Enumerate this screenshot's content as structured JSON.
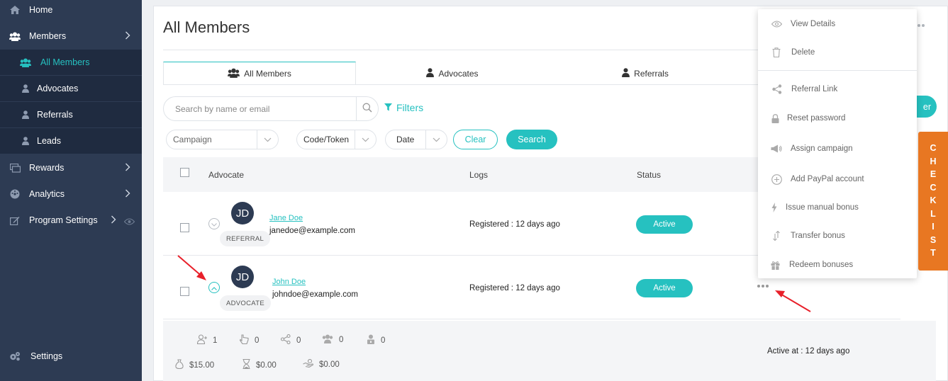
{
  "sidebar": {
    "items": [
      {
        "label": "Home",
        "icon": "home-icon"
      },
      {
        "label": "Members",
        "icon": "users-icon"
      },
      {
        "label": "Rewards",
        "icon": "rewards-icon"
      },
      {
        "label": "Analytics",
        "icon": "analytics-icon"
      },
      {
        "label": "Program Settings",
        "icon": "edit-icon"
      },
      {
        "label": "Settings",
        "icon": "gears-icon"
      }
    ],
    "sub_items": [
      {
        "label": "All Members",
        "icon": "users-icon"
      },
      {
        "label": "Advocates",
        "icon": "user-icon"
      },
      {
        "label": "Referrals",
        "icon": "user-icon"
      },
      {
        "label": "Leads",
        "icon": "user-icon"
      }
    ]
  },
  "page": {
    "title": "All Members"
  },
  "tabs": [
    {
      "label": "All Members"
    },
    {
      "label": "Advocates"
    },
    {
      "label": "Referrals"
    }
  ],
  "search": {
    "placeholder": "Search by name or email"
  },
  "filters_label": "Filters",
  "filter_selects": {
    "campaign": "Campaign",
    "code": "Code/Token",
    "date": "Date"
  },
  "buttons": {
    "clear": "Clear",
    "search": "Search",
    "add_partial": "er"
  },
  "table": {
    "headers": {
      "advocate": "Advocate",
      "logs": "Logs",
      "status": "Status"
    },
    "rows": [
      {
        "initials": "JD",
        "name": "Jane Doe",
        "email": "janedoe@example.com",
        "type": "REFERRAL",
        "log": "Registered : 12 days ago",
        "status": "Active"
      },
      {
        "initials": "JD",
        "name": "John Doe",
        "email": "johndoe@example.com",
        "type": "ADVOCATE",
        "log": "Registered : 12 days ago",
        "status": "Active"
      }
    ]
  },
  "details": {
    "counts": [
      "1",
      "0",
      "0",
      "0",
      "0"
    ],
    "amounts": [
      "$15.00",
      "$0.00",
      "$0.00"
    ],
    "active_at": "Active at : 12 days ago"
  },
  "menu": {
    "items": [
      {
        "label": "View Details",
        "icon": "eye-icon"
      },
      {
        "label": "Delete",
        "icon": "trash-icon"
      },
      {
        "label": "Referral Link",
        "icon": "share-icon"
      },
      {
        "label": "Reset password",
        "icon": "lock-icon"
      },
      {
        "label": "Assign campaign",
        "icon": "campaign-icon"
      },
      {
        "label": "Add PayPal account",
        "icon": "plus-circle-icon"
      },
      {
        "label": "Issue manual bonus",
        "icon": "bolt-icon"
      },
      {
        "label": "Transfer bonus",
        "icon": "transfer-icon"
      },
      {
        "label": "Redeem bonuses",
        "icon": "gift-icon"
      }
    ]
  },
  "checklist": [
    "C",
    "H",
    "E",
    "C",
    "K",
    "L",
    "I",
    "S",
    "T"
  ],
  "colors": {
    "accent": "#26c1c0",
    "sidebar": "#2d3b53",
    "sidebar_sub": "#1f2b40",
    "checklist": "#e87722",
    "annotation_arrow": "#e8202a"
  }
}
